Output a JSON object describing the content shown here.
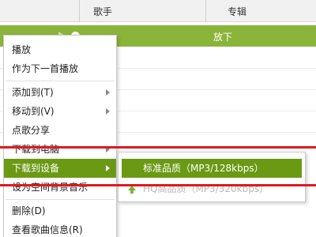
{
  "list_header": {
    "col_artist": "歌手",
    "col_album": "专辑"
  },
  "selected_row": {
    "cell_text": "放下"
  },
  "context_menu": {
    "items": [
      {
        "label": "播放"
      },
      {
        "label": "作为下一首播放"
      },
      {
        "label": "添加到(T)"
      },
      {
        "label": "移动到(V)"
      },
      {
        "label": "点歌分享"
      },
      {
        "label": "下载到电脑"
      },
      {
        "label": "下载到设备"
      },
      {
        "label": "设为空间背景音乐"
      },
      {
        "label": "删除(D)"
      },
      {
        "label": "查看歌曲信息(R)"
      }
    ],
    "active_item": "下载到设备"
  },
  "submenu": {
    "items": [
      {
        "label": "标准品质（MP3/128kbps）",
        "state": "active"
      },
      {
        "label": "HQ高品质（MP3/320kbps）",
        "state": "disabled",
        "icon": "green-arrow-icon"
      }
    ]
  },
  "colors": {
    "accent": "#6a9a14",
    "selected_row": "#8ab43a",
    "annotation": "#e0191f"
  }
}
